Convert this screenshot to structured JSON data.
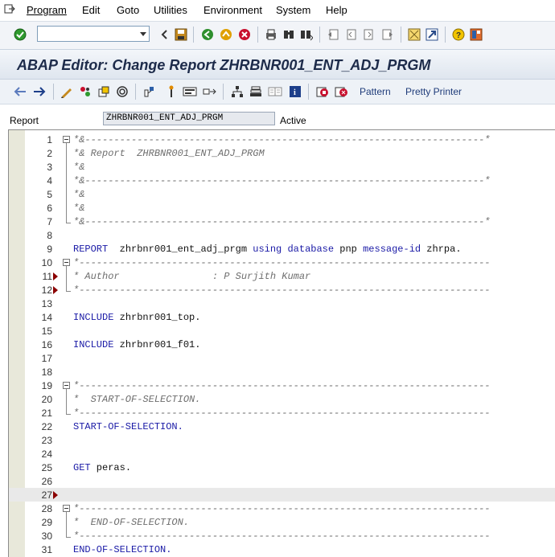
{
  "menu": [
    "Program",
    "Edit",
    "Goto",
    "Utilities",
    "Environment",
    "System",
    "Help"
  ],
  "toolbar": {
    "command_field_value": "",
    "icons": [
      "enter-icon",
      "back-icon",
      "save-icon",
      "back-green-icon",
      "exit-icon",
      "cancel-icon",
      "print-icon",
      "find-icon",
      "find-next-icon",
      "first-page-icon",
      "prev-page-icon",
      "next-page-icon",
      "last-page-icon",
      "new-session-icon",
      "shortcut-icon",
      "help-icon",
      "layout-icon"
    ]
  },
  "title": "ABAP Editor: Change Report ZHRBNR001_ENT_ADJ_PRGM",
  "app_toolbar": {
    "pattern_label": "Pattern",
    "pretty_printer_label": "Pretty Printer"
  },
  "report_field": {
    "label": "Report",
    "value": "ZHRBNR001_ENT_ADJ_PRGM",
    "status": "Active"
  },
  "editor": {
    "lines": [
      {
        "n": "1",
        "text": "*&---------------------------------------------------------------------*",
        "type": "cmt"
      },
      {
        "n": "2",
        "text": "*& Report  ZHRBNR001_ENT_ADJ_PRGM",
        "type": "cmt"
      },
      {
        "n": "3",
        "text": "*&",
        "type": "cmt"
      },
      {
        "n": "4",
        "text": "*&---------------------------------------------------------------------*",
        "type": "cmt"
      },
      {
        "n": "5",
        "text": "*&",
        "type": "cmt"
      },
      {
        "n": "6",
        "text": "*&",
        "type": "cmt"
      },
      {
        "n": "7",
        "text": "*&---------------------------------------------------------------------*",
        "type": "cmt"
      },
      {
        "n": "8",
        "text": "",
        "type": "blank"
      },
      {
        "n": "9",
        "text": "REPORT  zhrbnr001_ent_adj_prgm using database pnp message-id zhrpa.",
        "type": "report"
      },
      {
        "n": "10",
        "text": "*-----------------------------------------------------------------------",
        "type": "cmt"
      },
      {
        "n": "11",
        "text": "* Author                : P Surjith Kumar",
        "type": "cmt"
      },
      {
        "n": "12",
        "text": "*-----------------------------------------------------------------------",
        "type": "cmt"
      },
      {
        "n": "13",
        "text": "",
        "type": "blank"
      },
      {
        "n": "14",
        "text": "INCLUDE zhrbnr001_top.",
        "type": "include"
      },
      {
        "n": "15",
        "text": "",
        "type": "blank"
      },
      {
        "n": "16",
        "text": "INCLUDE zhrbnr001_f01.",
        "type": "include"
      },
      {
        "n": "17",
        "text": "",
        "type": "blank"
      },
      {
        "n": "18",
        "text": "",
        "type": "blank"
      },
      {
        "n": "19",
        "text": "*-----------------------------------------------------------------------",
        "type": "cmt"
      },
      {
        "n": "20",
        "text": "*  START-OF-SELECTION.",
        "type": "cmt"
      },
      {
        "n": "21",
        "text": "*-----------------------------------------------------------------------",
        "type": "cmt"
      },
      {
        "n": "22",
        "text": "START-OF-SELECTION.",
        "type": "kwline"
      },
      {
        "n": "23",
        "text": "",
        "type": "blank"
      },
      {
        "n": "24",
        "text": "",
        "type": "blank"
      },
      {
        "n": "25",
        "text": "GET peras.",
        "type": "get"
      },
      {
        "n": "26",
        "text": "",
        "type": "blank"
      },
      {
        "n": "27",
        "text": "",
        "type": "current"
      },
      {
        "n": "28",
        "text": "*-----------------------------------------------------------------------",
        "type": "cmt"
      },
      {
        "n": "29",
        "text": "*  END-OF-SELECTION.",
        "type": "cmt"
      },
      {
        "n": "30",
        "text": "*-----------------------------------------------------------------------",
        "type": "cmt"
      },
      {
        "n": "31",
        "text": "END-OF-SELECTION.",
        "type": "kwline"
      }
    ]
  }
}
